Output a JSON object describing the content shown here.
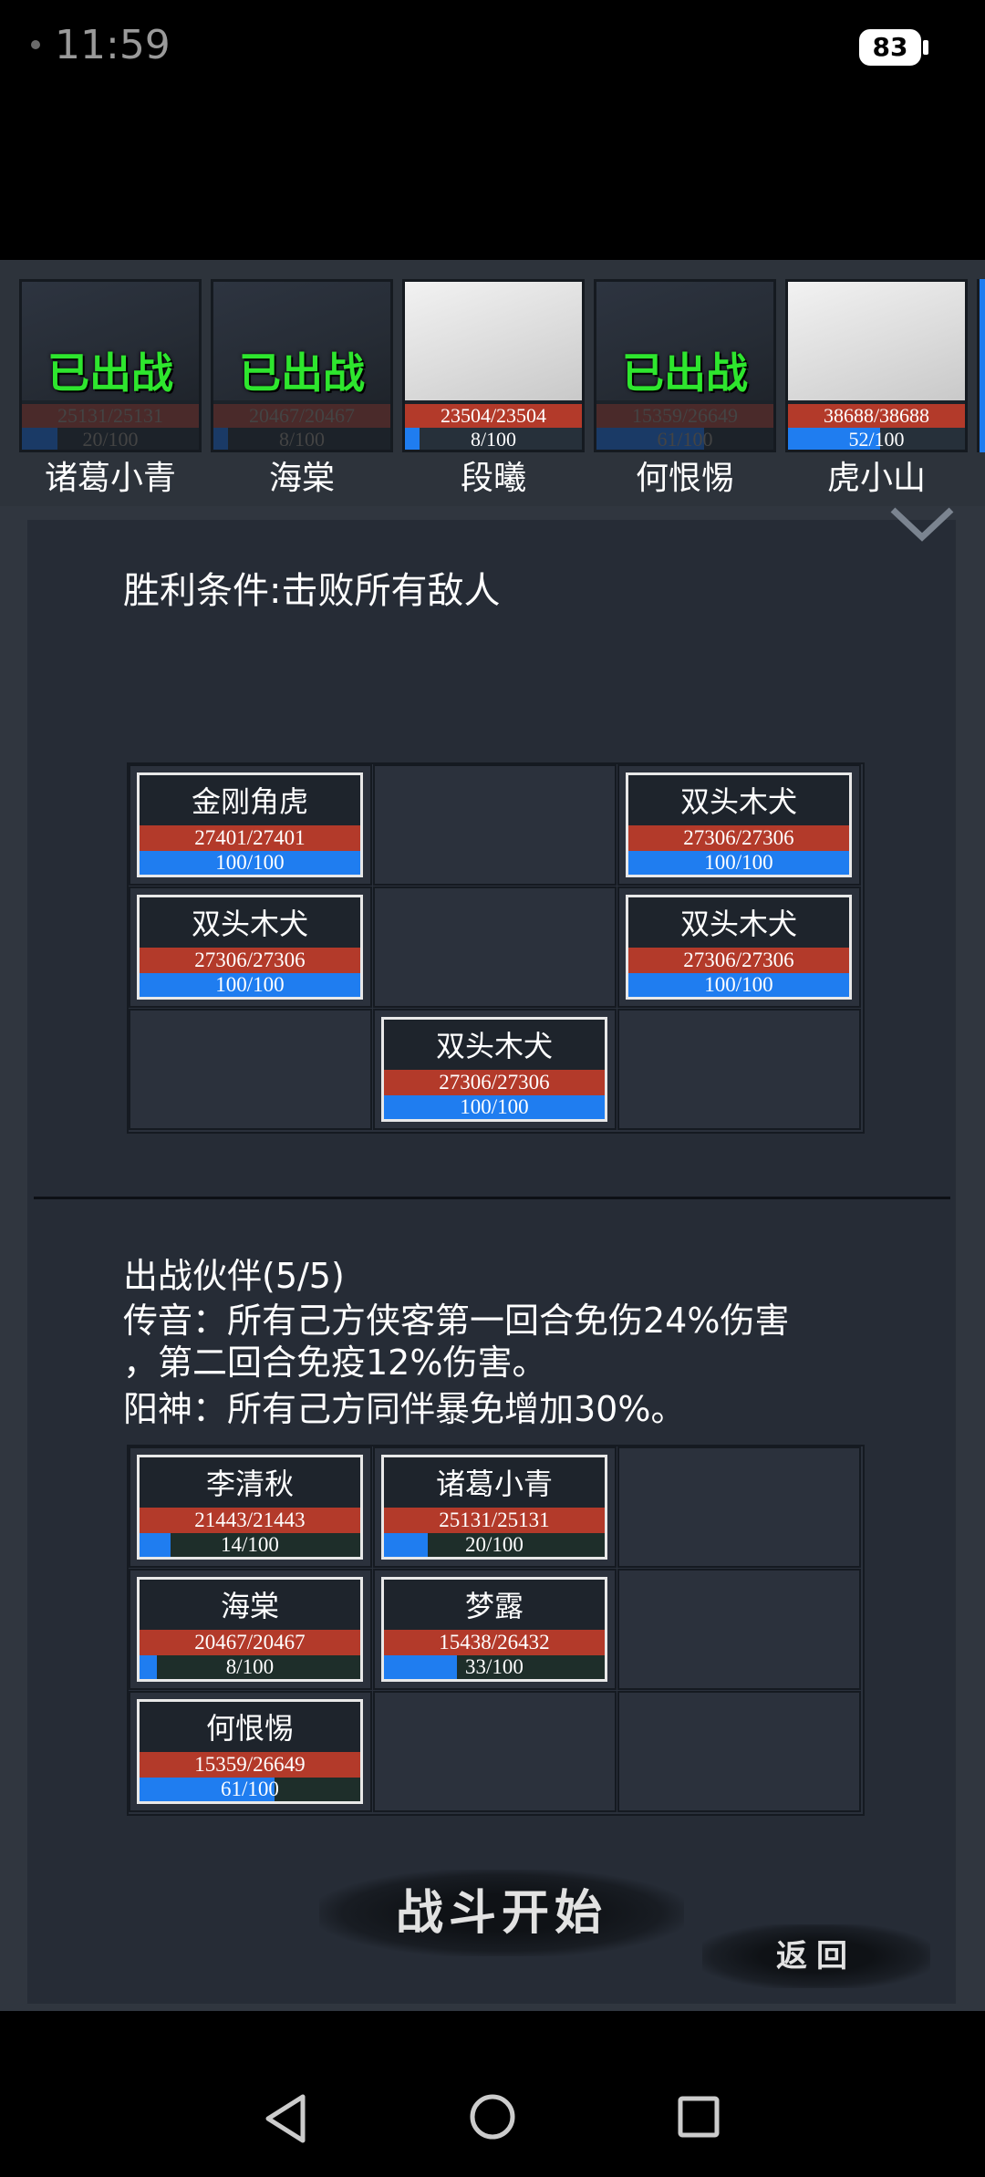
{
  "status": {
    "time": "11:59",
    "battery": "83"
  },
  "roster": [
    {
      "name": "诸葛小青",
      "hp": "25131/25131",
      "mp": "20/100",
      "mp_pct": 20,
      "deployed": true,
      "deployed_label": "已出战"
    },
    {
      "name": "海棠",
      "hp": "20467/20467",
      "mp": "8/100",
      "mp_pct": 8,
      "deployed": true,
      "deployed_label": "已出战"
    },
    {
      "name": "段曦",
      "hp": "23504/23504",
      "mp": "8/100",
      "mp_pct": 8,
      "deployed": false
    },
    {
      "name": "何恨惕",
      "hp": "15359/26649",
      "mp": "61/100",
      "mp_pct": 61,
      "deployed": true,
      "deployed_label": "已出战"
    },
    {
      "name": "虎小山",
      "hp": "38688/38688",
      "mp": "52/100",
      "mp_pct": 52,
      "deployed": false
    }
  ],
  "victory_condition": "胜利条件:击败所有敌人",
  "enemies": [
    {
      "name": "金刚角虎",
      "hp": "27401/27401",
      "mp": "100/100",
      "mp_pct": 100,
      "row": 0,
      "col": 0
    },
    {
      "name": "双头木犬",
      "hp": "27306/27306",
      "mp": "100/100",
      "mp_pct": 100,
      "row": 0,
      "col": 2
    },
    {
      "name": "双头木犬",
      "hp": "27306/27306",
      "mp": "100/100",
      "mp_pct": 100,
      "row": 1,
      "col": 0
    },
    {
      "name": "双头木犬",
      "hp": "27306/27306",
      "mp": "100/100",
      "mp_pct": 100,
      "row": 1,
      "col": 2
    },
    {
      "name": "双头木犬",
      "hp": "27306/27306",
      "mp": "100/100",
      "mp_pct": 100,
      "row": 2,
      "col": 1
    }
  ],
  "partners_title": "出战伙伴(5/5)",
  "buffs": [
    "传音：所有己方侠客第一回合免伤24%伤害",
    "，第二回合免疫12%伤害。",
    "阳神：所有己方同伴暴免增加30%。"
  ],
  "partners": [
    {
      "name": "李清秋",
      "hp": "21443/21443",
      "mp": "14/100",
      "mp_pct": 14,
      "row": 0,
      "col": 0
    },
    {
      "name": "诸葛小青",
      "hp": "25131/25131",
      "mp": "20/100",
      "mp_pct": 20,
      "row": 0,
      "col": 1
    },
    {
      "name": "海棠",
      "hp": "20467/20467",
      "mp": "8/100",
      "mp_pct": 8,
      "row": 1,
      "col": 0
    },
    {
      "name": "梦露",
      "hp": "15438/26432",
      "mp": "33/100",
      "mp_pct": 33,
      "row": 1,
      "col": 1
    },
    {
      "name": "何恨惕",
      "hp": "15359/26649",
      "mp": "61/100",
      "mp_pct": 61,
      "row": 2,
      "col": 0
    }
  ],
  "buttons": {
    "start": "战斗开始",
    "back": "返回"
  }
}
